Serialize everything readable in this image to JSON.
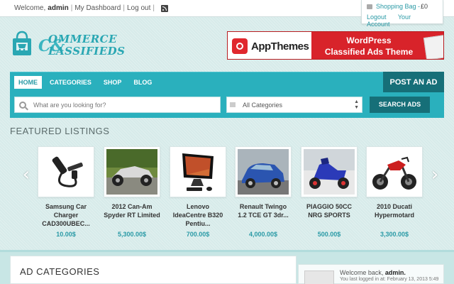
{
  "topbar": {
    "welcome_prefix": "Welcome,",
    "username": "admin",
    "dashboard_link": "My Dashboard",
    "logout_link": "Log out"
  },
  "cart": {
    "label": "Shopping Bag -",
    "amount": "£0",
    "logout": "Logout",
    "account": "Your Account"
  },
  "logo": {
    "line1": "OMMERCE",
    "line2": "LASSIFIEDS",
    "amp": "C&C"
  },
  "banner": {
    "brand": "AppThemes",
    "title_line1": "WordPress",
    "title_line2": "Classified Ads Theme"
  },
  "nav": {
    "items": [
      {
        "label": "HOME",
        "active": true
      },
      {
        "label": "CATEGORIES",
        "active": false
      },
      {
        "label": "SHOP",
        "active": false
      },
      {
        "label": "BLOG",
        "active": false
      }
    ],
    "post_ad": "POST AN AD"
  },
  "search": {
    "placeholder": "What are you looking for?",
    "category_value": "All Categories",
    "button": "SEARCH ADS"
  },
  "featured": {
    "title": "FEATURED LISTINGS",
    "listings": [
      {
        "name": "Samsung Car Charger CAD300UBEC...",
        "price": "10.00$",
        "image": "car-charger"
      },
      {
        "name": "2012 Can-Am Spyder RT Limited",
        "price": "5,300.00$",
        "image": "spyder"
      },
      {
        "name": "Lenovo IdeaCentre B320 Pentiu...",
        "price": "700.00$",
        "image": "computer"
      },
      {
        "name": "Renault Twingo 1.2 TCE GT 3dr...",
        "price": "4,000.00$",
        "image": "car"
      },
      {
        "name": "PIAGGIO 50CC NRG SPORTS",
        "price": "500.00$",
        "image": "scooter"
      },
      {
        "name": "2010 Ducati Hypermotard",
        "price": "3,300.00$",
        "image": "motorbike"
      }
    ]
  },
  "ad_categories": {
    "title": "AD CATEGORIES"
  },
  "welcome_box": {
    "prefix": "Welcome back,",
    "username": "admin.",
    "last_login": "You last logged in at: February 13, 2013 5:49"
  }
}
